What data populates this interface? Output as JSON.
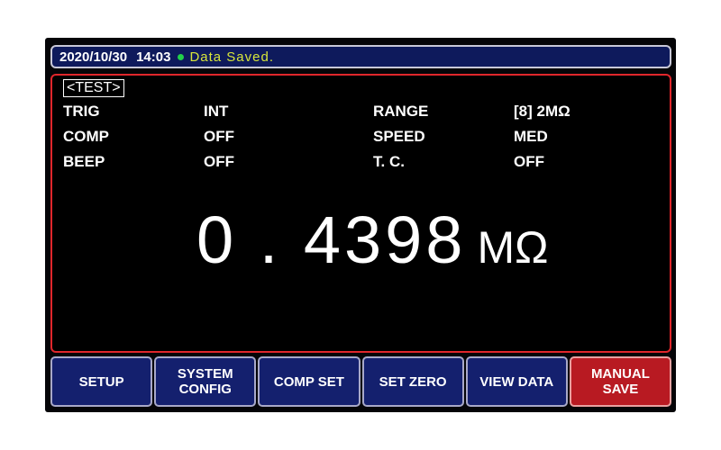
{
  "status_bar": {
    "date": "2020/10/30",
    "time": "14:03",
    "message": "Data  Saved.",
    "indicator_color": "#22d14a"
  },
  "page": {
    "tag": "<TEST>"
  },
  "params": {
    "trig": {
      "label": "TRIG",
      "value": "INT"
    },
    "comp": {
      "label": "COMP",
      "value": "OFF"
    },
    "beep": {
      "label": "BEEP",
      "value": "OFF"
    },
    "range": {
      "label": "RANGE",
      "value": "[8]  2MΩ"
    },
    "speed": {
      "label": "SPEED",
      "value": "MED"
    },
    "tc": {
      "label": "T. C.",
      "value": "OFF"
    }
  },
  "measurement": {
    "value": "0 . 4398",
    "unit": "MΩ"
  },
  "softkeys": [
    {
      "label": "SETUP"
    },
    {
      "label": "SYSTEM\nCONFIG"
    },
    {
      "label": "COMP  SET"
    },
    {
      "label": "SET  ZERO"
    },
    {
      "label": "VIEW  DATA"
    },
    {
      "label": "MANUAL\nSAVE"
    }
  ],
  "colors": {
    "status_bg": "#0e1a5c",
    "panel_border": "#e0262b",
    "softkey_bg": "#14206e",
    "softkey_active_bg": "#b81a22",
    "status_message": "#d7e63a"
  }
}
